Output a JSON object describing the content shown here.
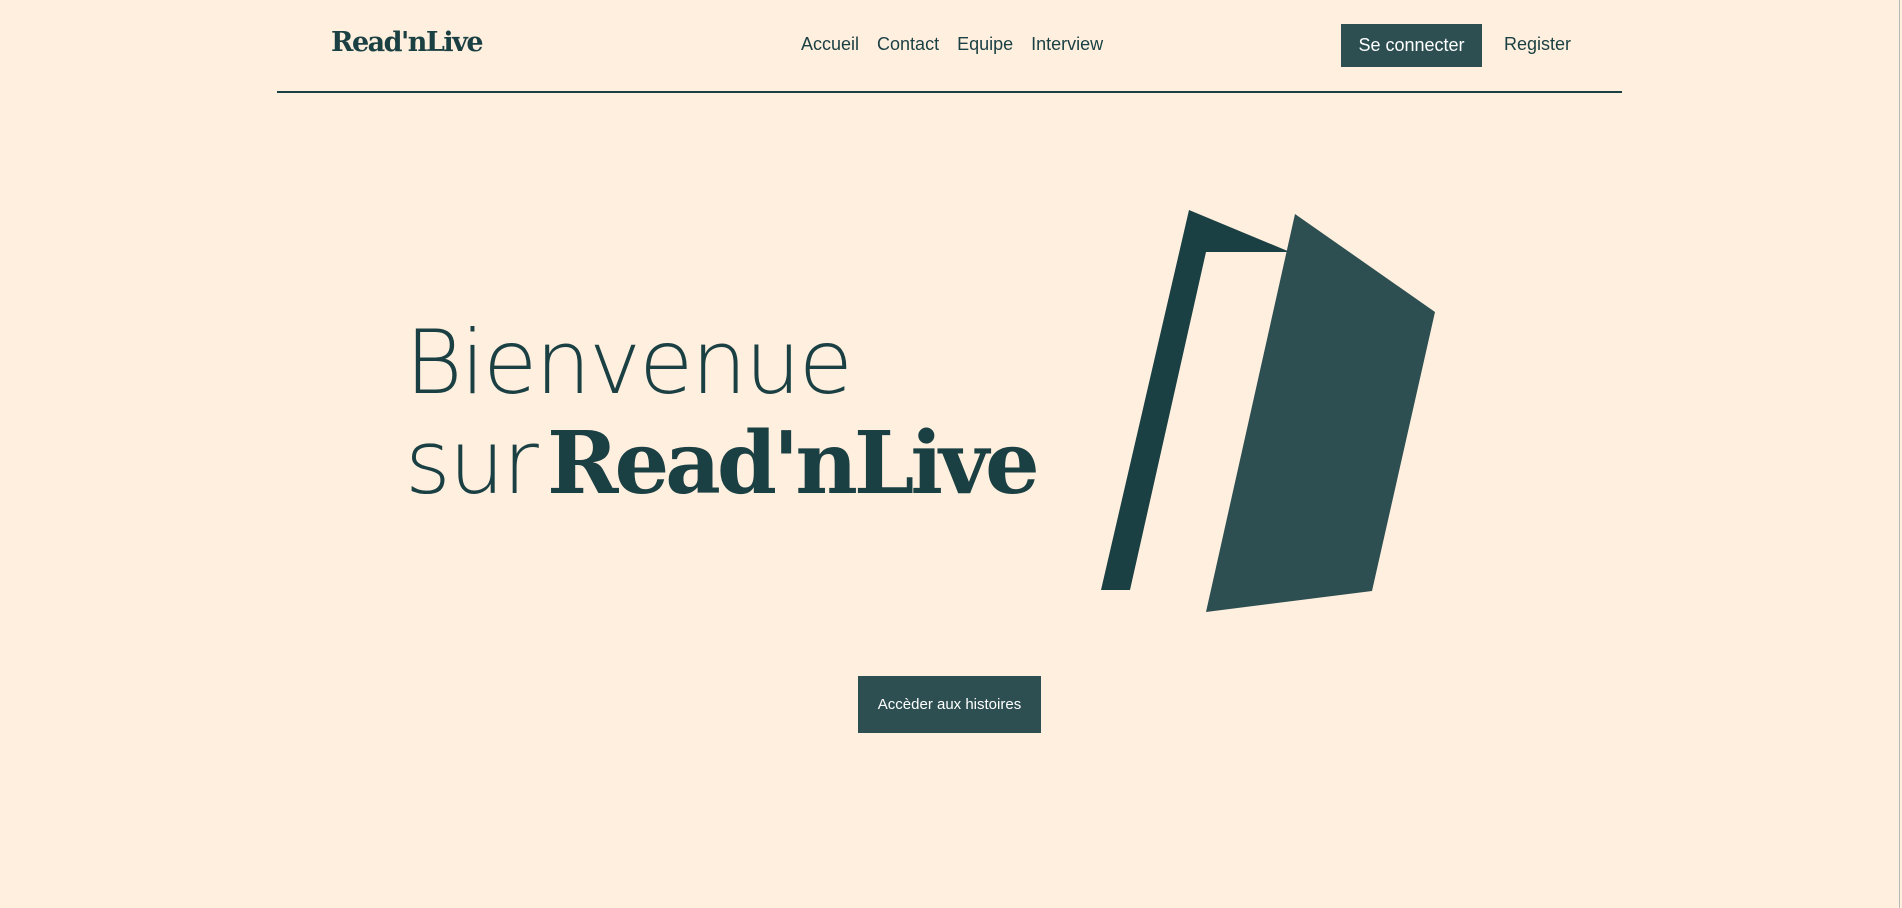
{
  "header": {
    "logo": "Read'nLive",
    "nav": [
      {
        "label": "Accueil"
      },
      {
        "label": "Contact"
      },
      {
        "label": "Equipe"
      },
      {
        "label": "Interview"
      }
    ],
    "login_label": "Se connecter",
    "register_label": "Register"
  },
  "hero": {
    "line1": "Bienvenue",
    "line2_prefix": "sur",
    "line2_brand": "Read'nLive",
    "cta_label": "Accèder aux histoires"
  },
  "colors": {
    "background": "#ffefdf",
    "primary": "#1b4043",
    "button": "#2d4f52",
    "button_text": "#ffffff"
  },
  "icons": {
    "hero_image": "open-door-icon"
  }
}
